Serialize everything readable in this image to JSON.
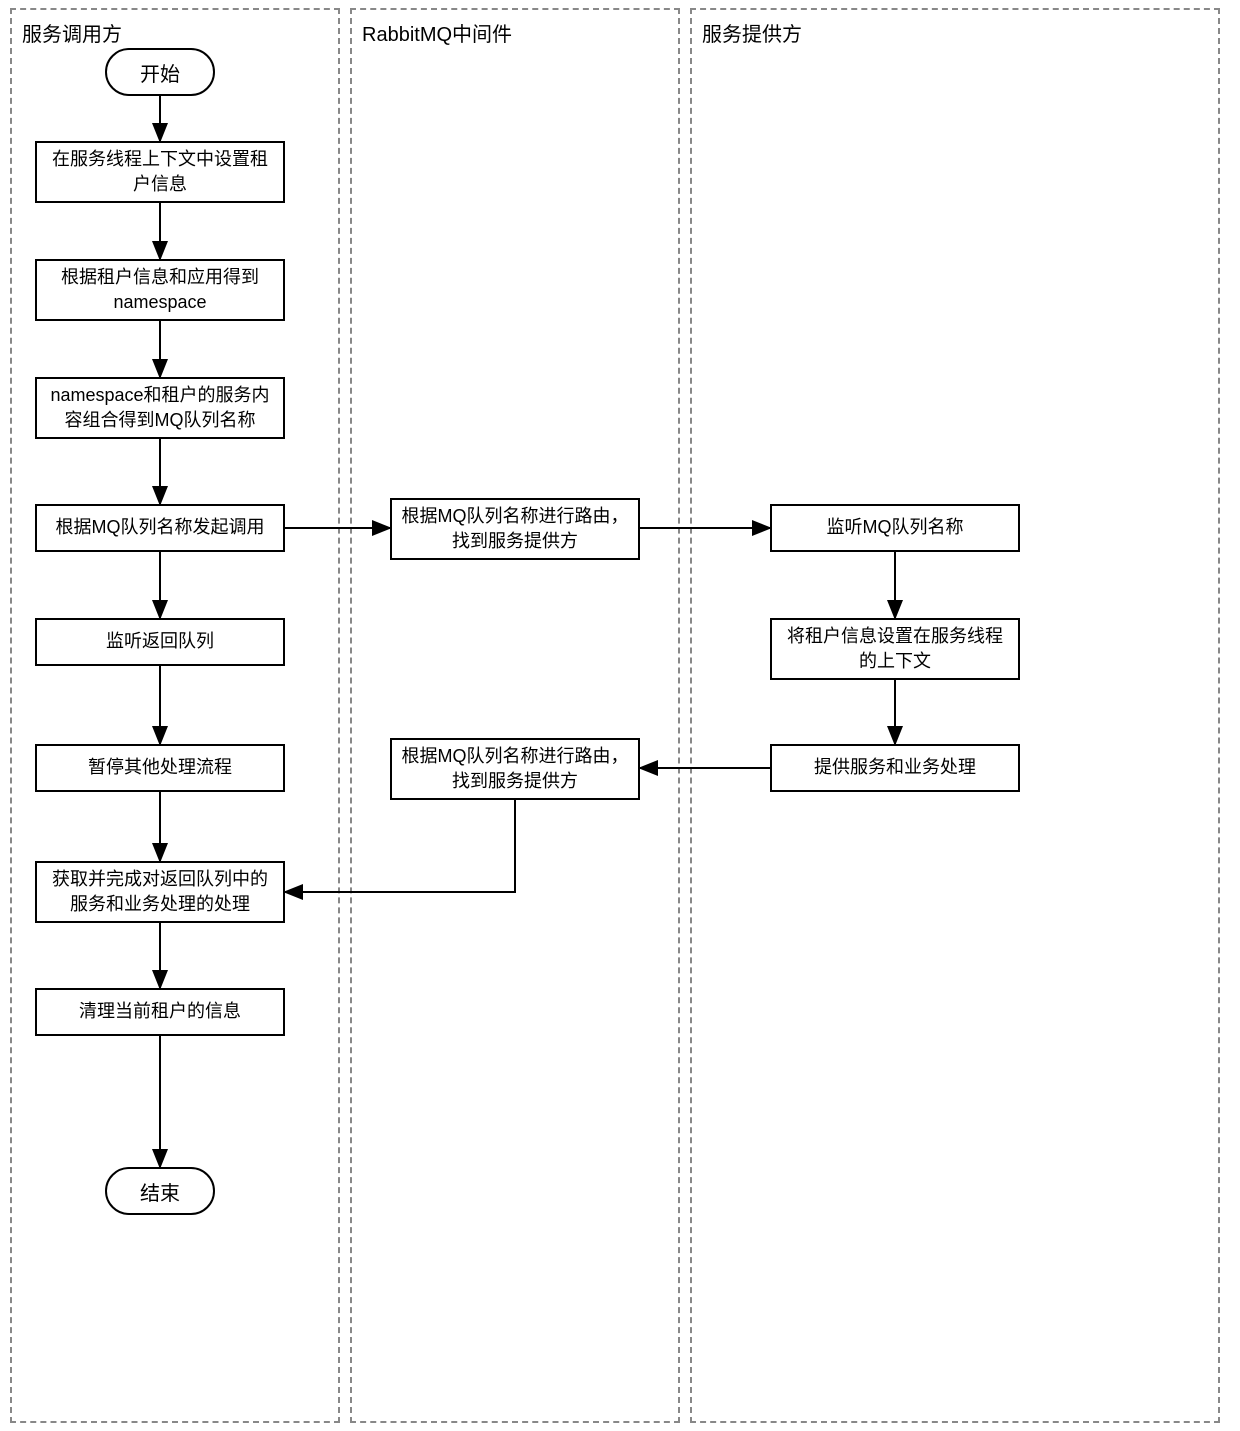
{
  "lanes": {
    "caller": "服务调用方",
    "middleware": "RabbitMQ中间件",
    "provider": "服务提供方"
  },
  "terminators": {
    "start": "开始",
    "end": "结束"
  },
  "caller": {
    "step1": "在服务线程上下文中设置租户信息",
    "step2": "根据租户信息和应用得到namespace",
    "step3": "namespace和租户的服务内容组合得到MQ队列名称",
    "step4": "根据MQ队列名称发起调用",
    "step5": "监听返回队列",
    "step6": "暂停其他处理流程",
    "step7": "获取并完成对返回队列中的服务和业务处理的处理",
    "step8": "清理当前租户的信息"
  },
  "middleware": {
    "route1": "根据MQ队列名称进行路由，找到服务提供方",
    "route2": "根据MQ队列名称进行路由，找到服务提供方"
  },
  "provider": {
    "listen": "监听MQ队列名称",
    "setctx": "将租户信息设置在服务线程的上下文",
    "process": "提供服务和业务处理"
  }
}
